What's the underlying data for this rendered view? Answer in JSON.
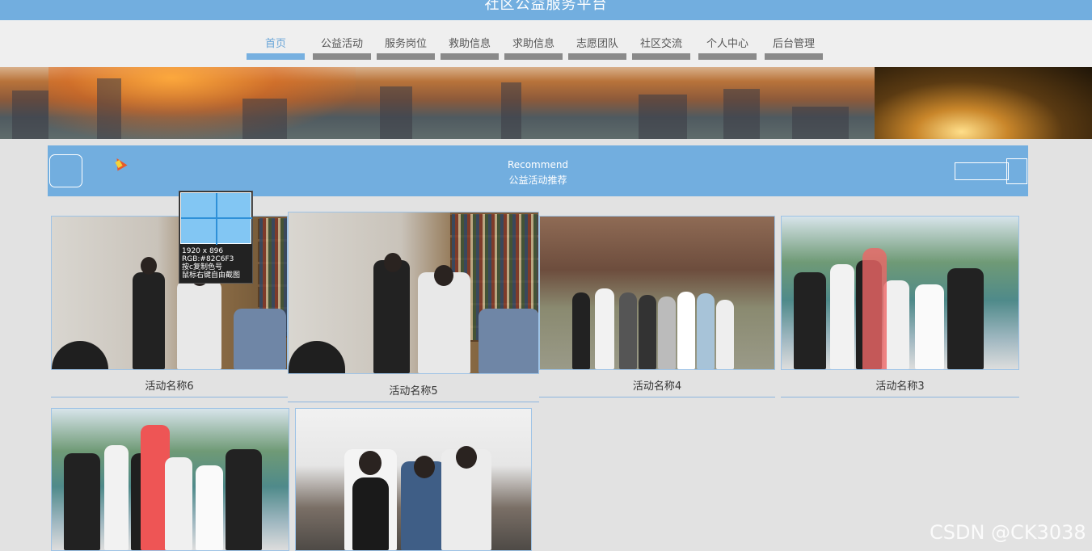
{
  "header": {
    "site_title": "社区公益服务平台"
  },
  "nav": {
    "items": [
      {
        "label": "首页",
        "active": true
      },
      {
        "label": "公益活动"
      },
      {
        "label": "服务岗位"
      },
      {
        "label": "救助信息"
      },
      {
        "label": "求助信息"
      },
      {
        "label": "志愿团队"
      },
      {
        "label": "社区交流"
      },
      {
        "label": "个人中心"
      },
      {
        "label": "后台管理"
      }
    ]
  },
  "recommend": {
    "title_en": "Recommend",
    "title_zh": "公益活动推荐",
    "prev_icon": "chevron-left-icon",
    "next_icon": "chevron-right-icon"
  },
  "activities": [
    {
      "name": "活动名称6",
      "scene": "office"
    },
    {
      "name": "活动名称5",
      "scene": "office"
    },
    {
      "name": "活动名称4",
      "scene": "temple"
    },
    {
      "name": "活动名称3",
      "scene": "lake"
    },
    {
      "name": "",
      "scene": "lake"
    },
    {
      "name": "",
      "scene": "gate"
    }
  ],
  "color_picker": {
    "size": "1920 x 896",
    "rgb": "RGB:#82C6F3",
    "hint_copy": "按c复制色号",
    "hint_shot": "鼠标右键自由截图",
    "color": "#82C6F3"
  },
  "watermark": "CSDN @CK3038",
  "colors": {
    "accent": "#72aedf",
    "nav_active": "#6aa6d8"
  }
}
